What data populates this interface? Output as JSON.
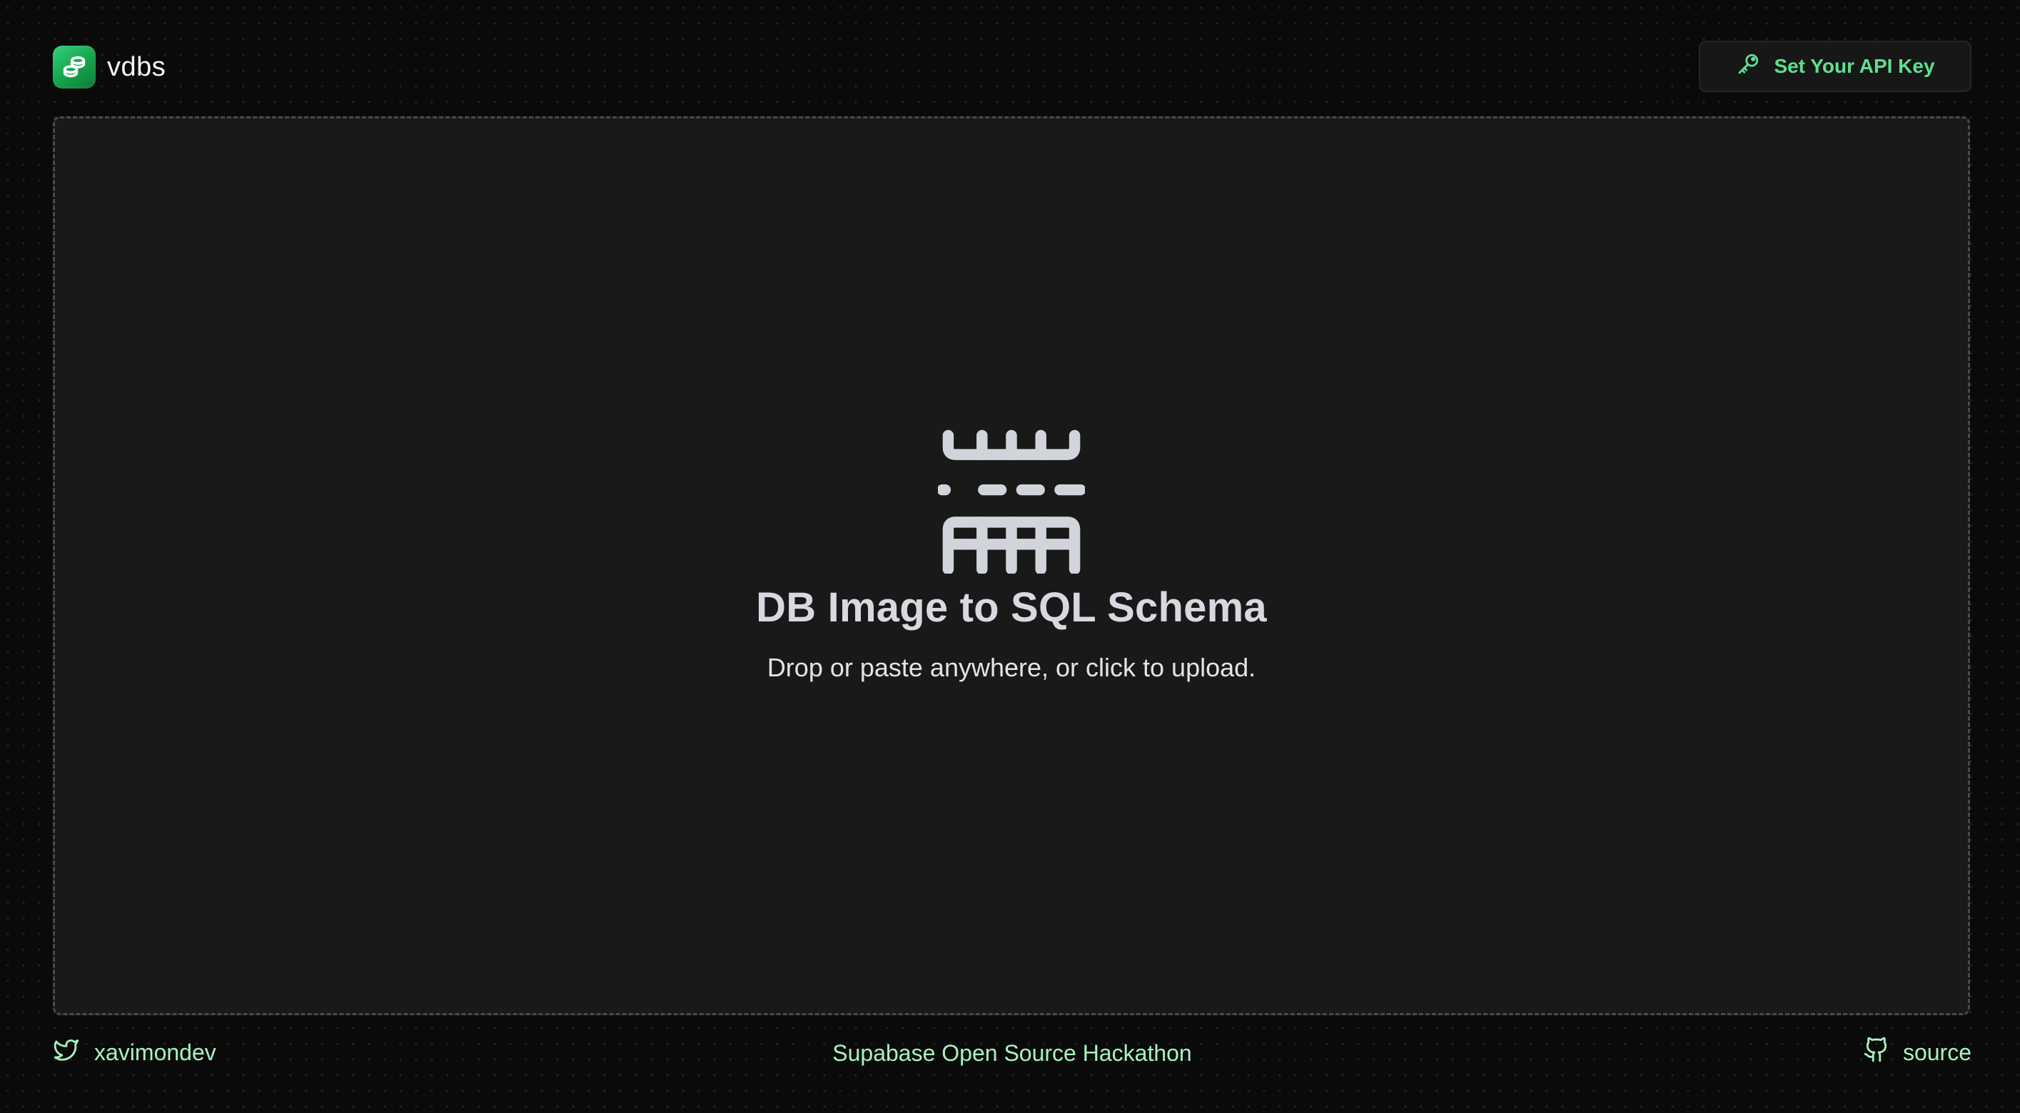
{
  "header": {
    "brand_name": "vdbs",
    "api_button_label": "Set Your API Key"
  },
  "dropzone": {
    "title": "DB Image to SQL Schema",
    "subtitle": "Drop or paste anywhere, or click to upload.",
    "icon": "table-schema-icon"
  },
  "footer": {
    "twitter_handle": "xavimondev",
    "center_link": "Supabase Open Source Hackathon",
    "source_link": "source"
  },
  "colors": {
    "background": "#0a0a0a",
    "panel": "#191919",
    "accent_green": "#5fe08f",
    "footer_text": "#a7f3c0",
    "logo_green": "#16a34a"
  }
}
